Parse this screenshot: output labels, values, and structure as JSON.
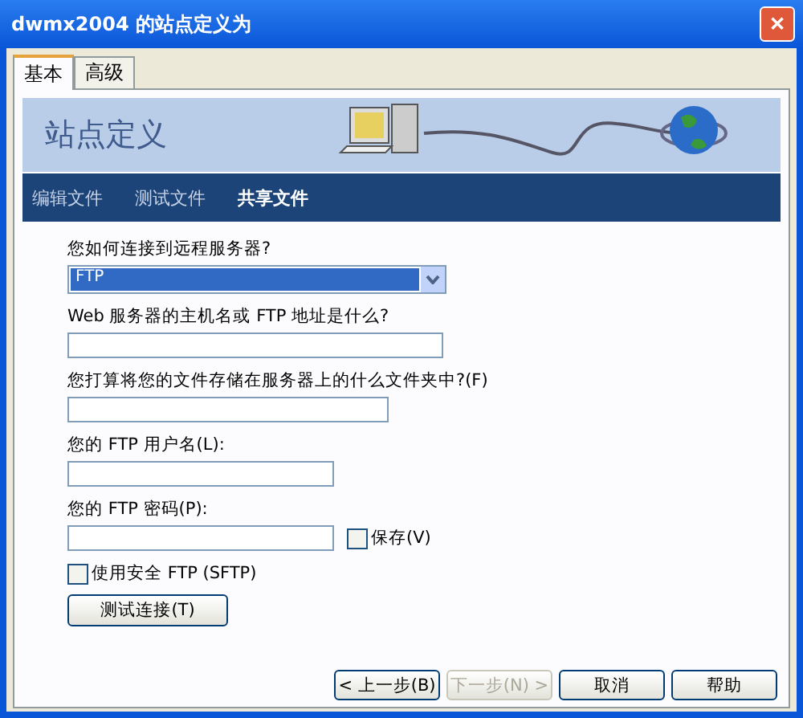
{
  "window": {
    "title": "dwmx2004 的站点定义为",
    "close": "✕"
  },
  "tabs": [
    {
      "label": "基本",
      "selected": true
    },
    {
      "label": "高级",
      "selected": false
    }
  ],
  "banner": {
    "title": "站点定义"
  },
  "steps": [
    {
      "label": "编辑文件",
      "selected": false
    },
    {
      "label": "测试文件",
      "selected": false
    },
    {
      "label": "共享文件",
      "selected": true
    }
  ],
  "form": [
    {
      "kind": "select",
      "label": "您如何连接到远程服务器?",
      "value": "FTP"
    },
    {
      "kind": "input",
      "label": "Web 服务器的主机名或 FTP 地址是什么?"
    },
    {
      "kind": "input",
      "label": "您打算将您的文件存储在服务器上的什么文件夹中?(F)"
    },
    {
      "kind": "input",
      "label": "您的 FTP 用户名(L):"
    },
    {
      "kind": "input",
      "label": "您的 FTP 密码(P):",
      "check": {
        "label": "保存(V)",
        "checked": false
      }
    },
    {
      "kind": "checkbox",
      "label": "使用安全 FTP (SFTP)",
      "checked": false
    },
    {
      "kind": "button",
      "label": "测试连接(T)"
    }
  ],
  "buttons": [
    {
      "label": "< 上一步(B)",
      "disabled": false
    },
    {
      "label": "下一步(N) >",
      "disabled": true
    },
    {
      "label": "取消",
      "disabled": false
    },
    {
      "label": "帮助",
      "disabled": false
    }
  ]
}
